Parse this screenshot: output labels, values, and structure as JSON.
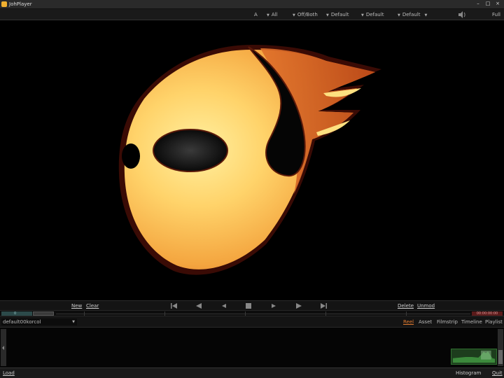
{
  "window": {
    "title": "JohPlayer",
    "controls": [
      "–",
      "□",
      "×"
    ]
  },
  "toolbar": {
    "items": [
      {
        "label": "A"
      },
      {
        "label": "All"
      },
      {
        "label": "Off/Both"
      },
      {
        "label": "Default"
      },
      {
        "label": "Default"
      },
      {
        "label": "Default"
      }
    ],
    "full_label": "Full"
  },
  "transport": {
    "new_label": "New",
    "clear_label": "Clear",
    "delete_label": "Delete",
    "unmod_label": "Unmod",
    "buttons": [
      "first-frame-icon",
      "step-back-icon",
      "play-reverse-icon",
      "stop-icon",
      "play-icon",
      "step-forward-icon",
      "last-frame-icon"
    ]
  },
  "timeline": {
    "start_value": "0",
    "end_value": "00:00:00:00"
  },
  "panel": {
    "shot_value": "default00korcol",
    "tabs": [
      {
        "label": "Reel",
        "active": true
      },
      {
        "label": "Asset",
        "active": false
      },
      {
        "label": "Filmstrip",
        "active": false
      },
      {
        "label": "Timeline",
        "active": false
      },
      {
        "label": "Playlist",
        "active": false
      }
    ]
  },
  "bottom": {
    "load_label": "Load",
    "histogram_label": "Histogram",
    "quit_label": "Quit"
  },
  "colors": {
    "accent_tab": "#e07a30",
    "mask_light": "#ffd36a",
    "mask_dark": "#d9611e"
  }
}
